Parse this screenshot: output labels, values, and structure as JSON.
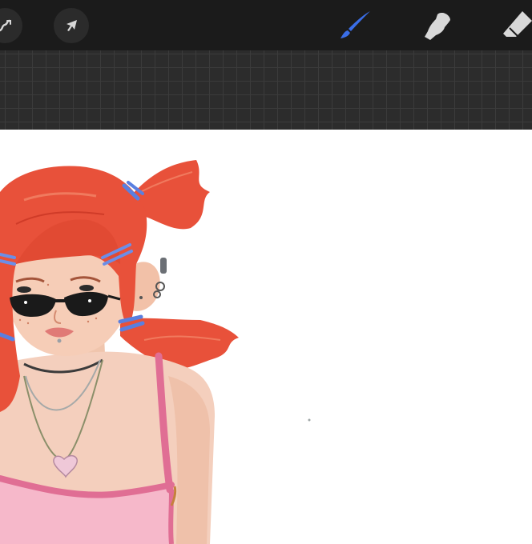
{
  "toolbar": {
    "left_tools": [
      {
        "name": "modify-icon"
      },
      {
        "name": "transform-arrow-icon"
      }
    ],
    "right_tools": [
      {
        "name": "brush-icon",
        "active": true
      },
      {
        "name": "smudge-icon",
        "active": false
      },
      {
        "name": "eraser-icon",
        "active": false
      }
    ],
    "active_color": "#3a6ee8",
    "icon_color": "#d8d8d8"
  },
  "canvas": {
    "background": "#ffffff",
    "artwork": "illustration-girl-red-pigtails"
  }
}
